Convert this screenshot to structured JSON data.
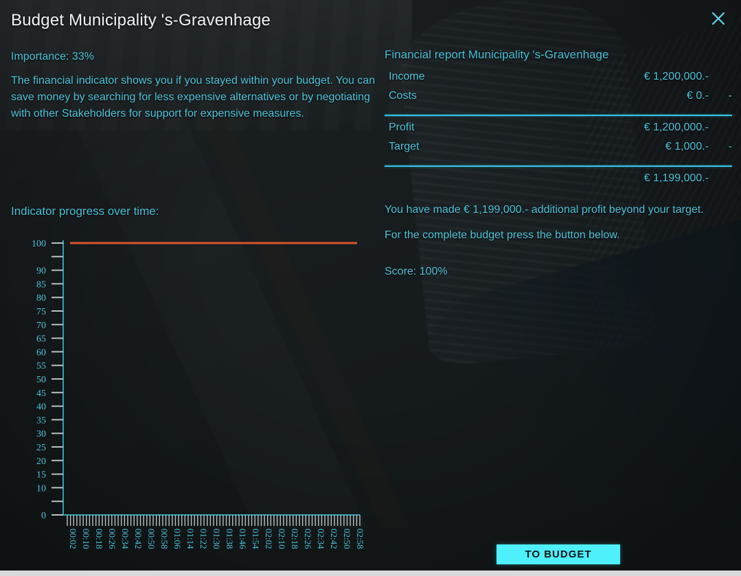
{
  "window": {
    "title": "Budget Municipality 's-Gravenhage",
    "close_icon": "close-icon"
  },
  "left": {
    "importance": "Importance: 33%",
    "description": "The financial indicator shows you if you stayed within your budget. You can save money by searching for less expensive alternatives or by negotiating with other Stakeholders for support for expensive measures.",
    "chart_heading": "Indicator progress over time:"
  },
  "report": {
    "title": "Financial report Municipality 's-Gravenhage",
    "rows": [
      {
        "label": "Income",
        "amount": "€ 1,200,000.-",
        "operator": ""
      },
      {
        "label": "Costs",
        "amount": "€ 0.-",
        "operator": "-"
      },
      {
        "label": "Profit",
        "amount": "€ 1,200,000.-",
        "operator": ""
      },
      {
        "label": "Target",
        "amount": "€ 1,000.-",
        "operator": "-"
      }
    ],
    "total": "€ 1,199,000.-",
    "note": "You have made € 1,199,000.- additional profit beyond your target.",
    "note2": "For the complete budget press the button below.",
    "score": "Score: 100%"
  },
  "actions": {
    "to_budget_label": "TO BUDGET"
  },
  "colors": {
    "accent_cyan": "#4fc3d8",
    "rule_cyan": "#35c6e6",
    "button_cyan": "#4ef0fb",
    "series_orange": "#d9552b",
    "axis_teal": "#2f9fb0",
    "tick_gray": "#b9c2c4",
    "title_white": "#eef4f6"
  },
  "chart_data": {
    "type": "line",
    "title": "Indicator progress over time:",
    "xlabel": "",
    "ylabel": "",
    "ylim": [
      0,
      100
    ],
    "grid": false,
    "legend": null,
    "y_ticks": [
      0,
      5,
      10,
      15,
      20,
      25,
      30,
      35,
      40,
      45,
      50,
      55,
      60,
      65,
      70,
      75,
      80,
      85,
      90,
      95,
      100
    ],
    "y_tick_labels": [
      "0",
      "",
      "10",
      "15",
      "20",
      "25",
      "30",
      "35",
      "40",
      "45",
      "50",
      "55",
      "60",
      "65",
      "70",
      "75",
      "80",
      "85",
      "90",
      "",
      "100"
    ],
    "x_tick_labels": [
      "00:02",
      "00:10",
      "00:18",
      "00:26",
      "00:34",
      "00:42",
      "00:50",
      "00:58",
      "01:06",
      "01:14",
      "01:22",
      "01:30",
      "01:38",
      "01:46",
      "01:54",
      "02:02",
      "02:10",
      "02:18",
      "02:26",
      "02:34",
      "02:42",
      "02:50",
      "02:58"
    ],
    "x_minor_tick_count": 92,
    "series": [
      {
        "name": "Indicator",
        "color": "#d9552b",
        "x": [
          "00:02",
          "00:10",
          "00:18",
          "00:26",
          "00:34",
          "00:42",
          "00:50",
          "00:58",
          "01:06",
          "01:14",
          "01:22",
          "01:30",
          "01:38",
          "01:46",
          "01:54",
          "02:02",
          "02:10",
          "02:18",
          "02:26",
          "02:34",
          "02:42",
          "02:50",
          "02:58"
        ],
        "values": [
          100,
          100,
          100,
          100,
          100,
          100,
          100,
          100,
          100,
          100,
          100,
          100,
          100,
          100,
          100,
          100,
          100,
          100,
          100,
          100,
          100,
          100,
          100
        ]
      }
    ]
  }
}
